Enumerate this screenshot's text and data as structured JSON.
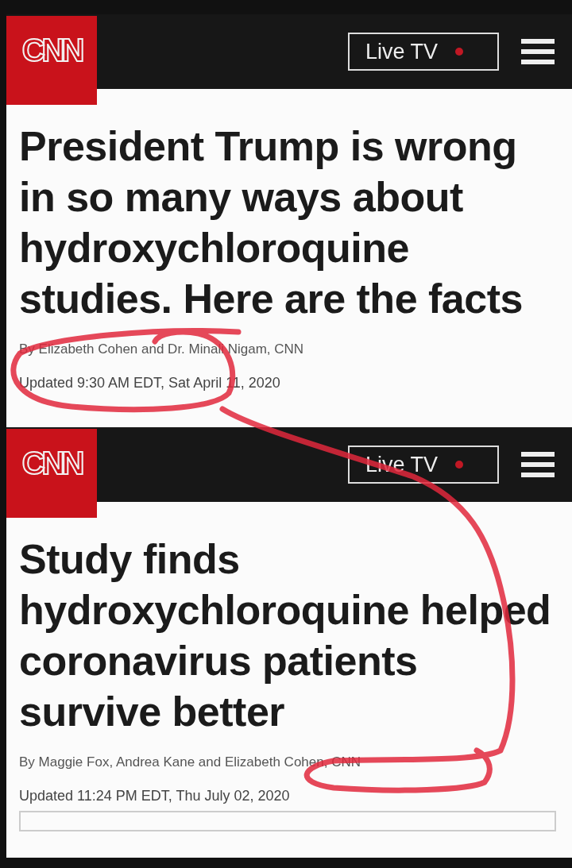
{
  "articles": [
    {
      "logo": "CNN",
      "live_button": "Live TV",
      "headline": "President Trump is wrong in so many ways about hydroxychloroquine studies. Here are the facts",
      "byline": "By Elizabeth Cohen and Dr. Minali Nigam, CNN",
      "updated": "Updated 9:30 AM EDT, Sat April 11, 2020"
    },
    {
      "logo": "CNN",
      "live_button": "Live TV",
      "headline": "Study finds hydroxychloroquine helped coronavirus patients survive better",
      "byline": "By Maggie Fox, Andrea Kane and Elizabeth Cohen, CNN",
      "updated": "Updated 11:24 PM EDT, Thu July 02, 2020"
    }
  ]
}
